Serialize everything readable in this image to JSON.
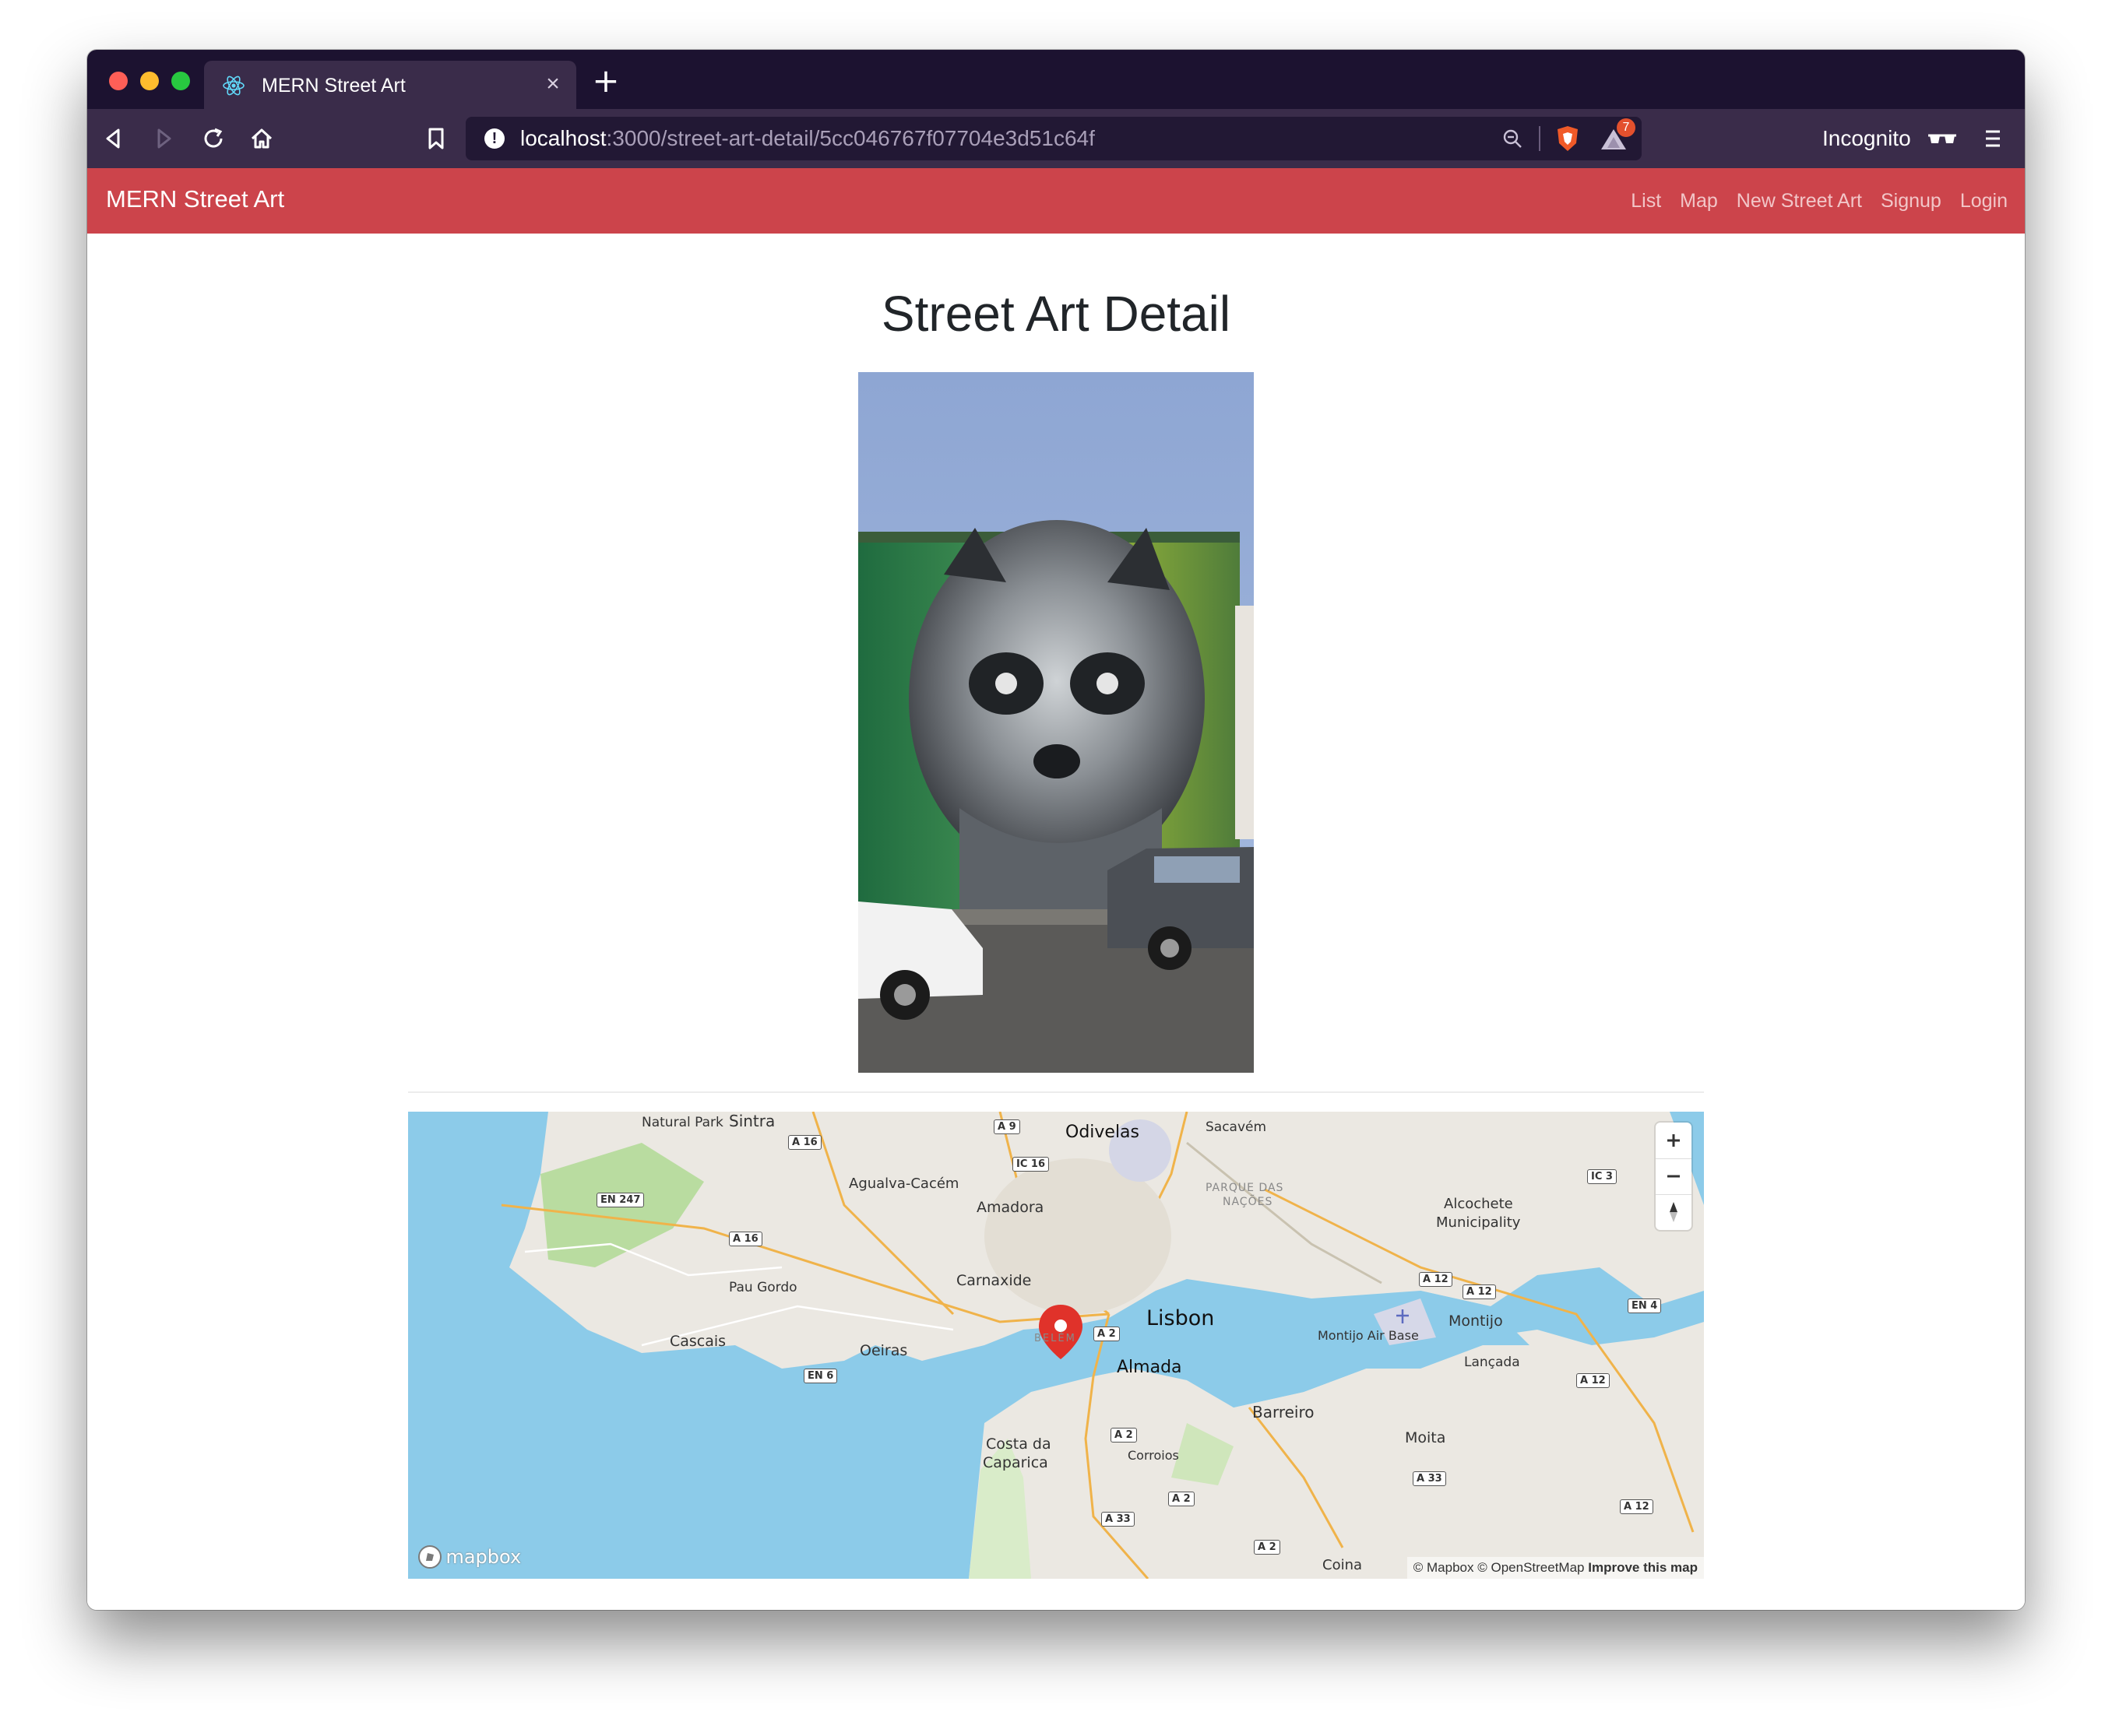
{
  "browser": {
    "tab_title": "MERN Street Art",
    "new_tab_icon": "plus-icon",
    "url_host": "localhost",
    "url_rest": ":3000/street-art-detail/5cc046767f07704e3d51c64f",
    "rewards_badge": "7",
    "incognito_label": "Incognito"
  },
  "navbar": {
    "brand": "MERN Street Art",
    "links": [
      "List",
      "Map",
      "New Street Art",
      "Signup",
      "Login"
    ],
    "bg_color": "#cc444b"
  },
  "page": {
    "title": "Street Art Detail"
  },
  "map": {
    "zoom_in": "+",
    "zoom_out": "−",
    "places": {
      "lisbon": "Lisbon",
      "almada": "Almada",
      "odivelas": "Odivelas",
      "sacavem": "Sacavém",
      "amadora": "Amadora",
      "agualva": "Agualva-Cacém",
      "carnaxide": "Carnaxide",
      "pau_gordo": "Pau Gordo",
      "cascais": "Cascais",
      "oeiras": "Oeiras",
      "sintra": "Sintra",
      "natural_park": "Natural Park",
      "costa_caparica_1": "Costa da",
      "costa_caparica_2": "Caparica",
      "corroios": "Corroios",
      "barreiro": "Barreiro",
      "moita": "Moita",
      "montijo": "Montijo",
      "montijo_air_base": "Montijo Air Base",
      "lancada": "Lançada",
      "alcochete_1": "Alcochete",
      "alcochete_2": "Municipality",
      "coina": "Coina",
      "parque_nacoes_1": "PARQUE DAS",
      "parque_nacoes_2": "NAÇÕES",
      "belem": "BELÉM"
    },
    "roads": [
      "A 16",
      "A 9",
      "IC 16",
      "EN 247",
      "A 16",
      "A 2",
      "EN 6",
      "A 2",
      "A 2",
      "A 33",
      "A 12",
      "A 12",
      "A 12",
      "A 33",
      "A 12",
      "EN 4",
      "IC 3",
      "A 2"
    ],
    "attribution_mapbox": "© Mapbox",
    "attribution_osm": "© OpenStreetMap",
    "attribution_improve": "Improve this map",
    "logo_text": "mapbox",
    "marker_color": "#e0322a"
  }
}
